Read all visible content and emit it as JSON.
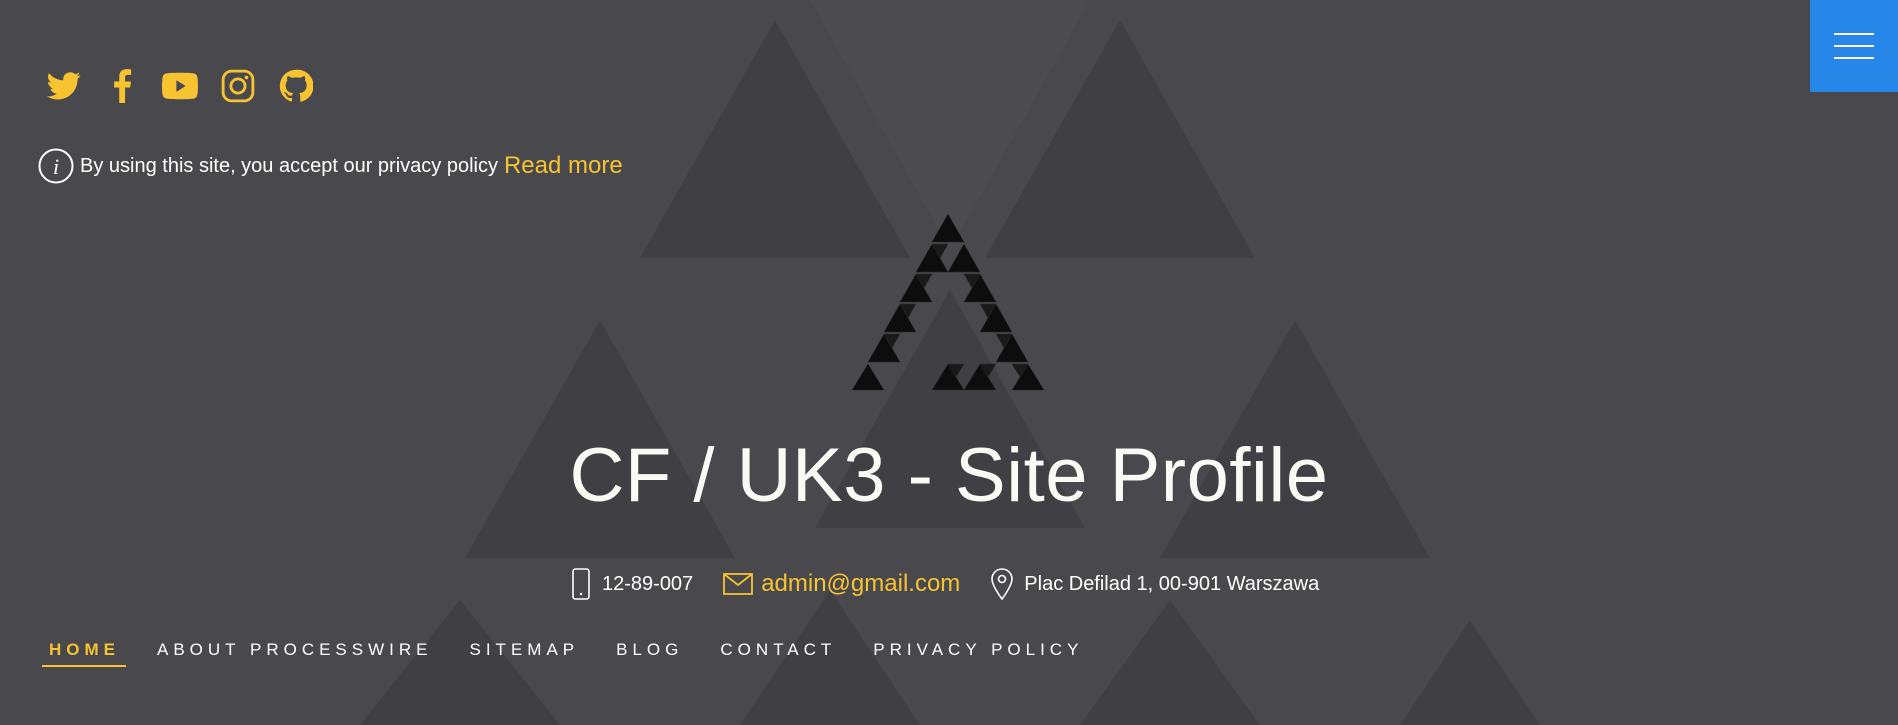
{
  "social": [
    {
      "icon": "twitter-icon"
    },
    {
      "icon": "facebook-icon"
    },
    {
      "icon": "youtube-icon"
    },
    {
      "icon": "instagram-icon"
    },
    {
      "icon": "github-icon"
    }
  ],
  "privacy": {
    "icon": "info-icon",
    "text": "By using this site, you accept our privacy policy",
    "link": "Read more"
  },
  "menu_toggle": {
    "icon": "hamburger-menu-icon"
  },
  "site_title": "CF / UK3 - Site Profile",
  "contact": {
    "phone": "12-89-007",
    "email": "admin@gmail.com",
    "address": "Plac Defilad 1, 00-901 Warszawa"
  },
  "nav": {
    "items": [
      "HOME",
      "ABOUT PROCESSWIRE",
      "SITEMAP",
      "BLOG",
      "CONTACT",
      "PRIVACY POLICY"
    ],
    "active": "HOME"
  },
  "colors": {
    "background": "#48484d",
    "accent": "#f7c331",
    "menu_button": "#2787e8",
    "title": "#fafaf5"
  }
}
